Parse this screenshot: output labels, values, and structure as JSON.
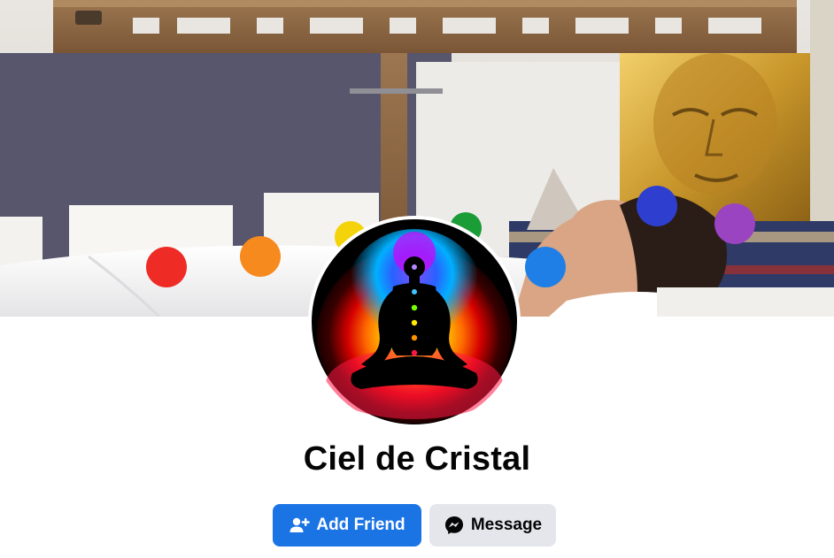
{
  "profile": {
    "name": "Ciel de Cristal"
  },
  "actions": {
    "add_friend_label": "Add Friend",
    "message_label": "Message"
  },
  "icons": {
    "add_friend": "add-friend-icon",
    "message": "messenger-icon"
  },
  "colors": {
    "primary_button": "#1b74e4",
    "secondary_button": "#e4e6eb",
    "text": "#050505"
  }
}
